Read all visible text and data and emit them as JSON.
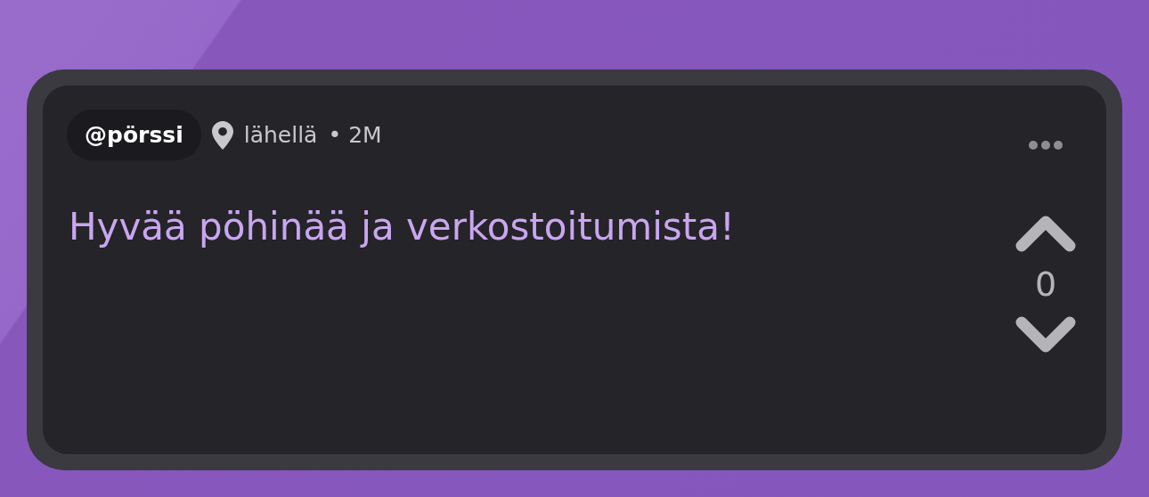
{
  "post": {
    "author": "@pörssi",
    "location": "lähellä",
    "time": "• 2M",
    "message": "Hyvää pöhinää ja verkostoitumista!",
    "score": "0"
  }
}
